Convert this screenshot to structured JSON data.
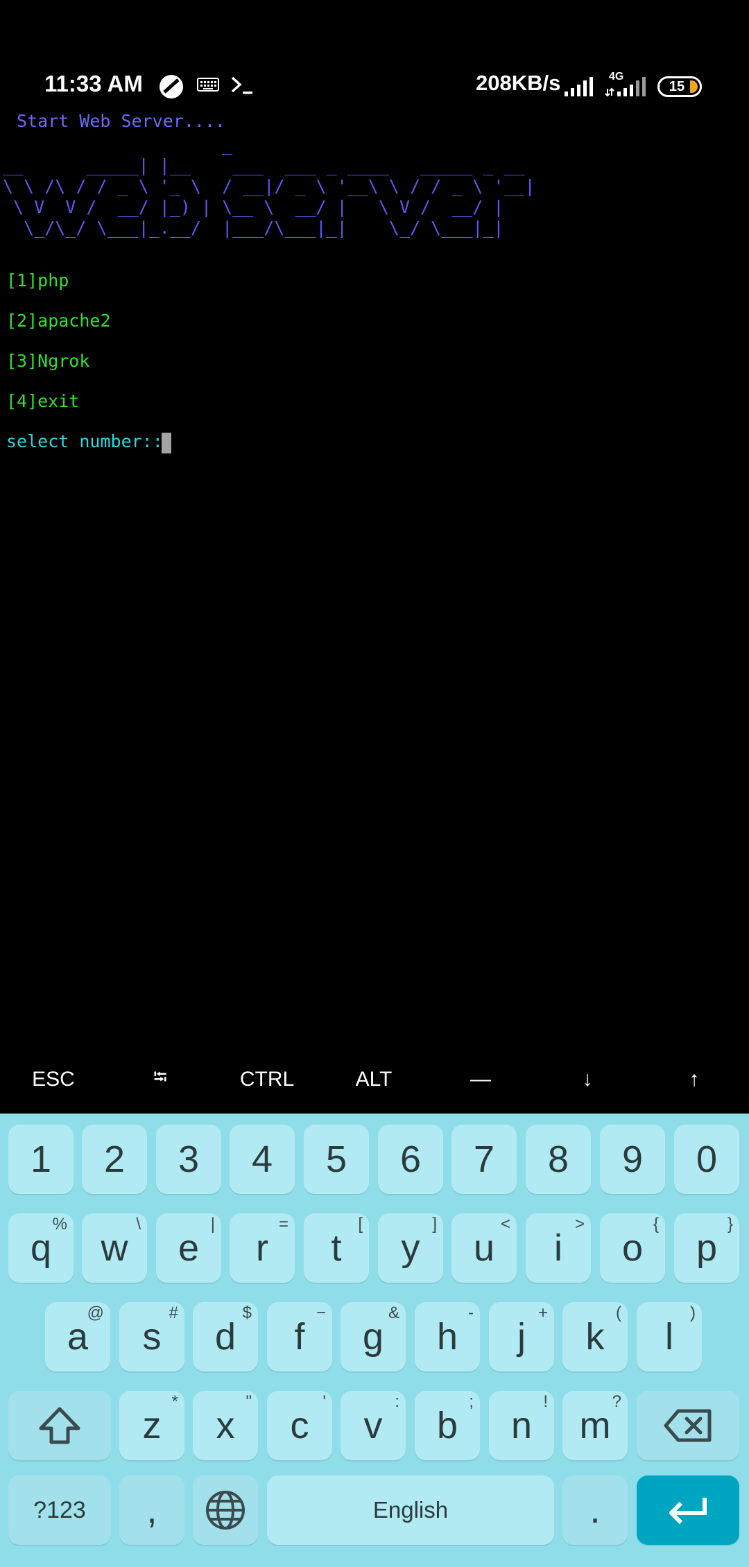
{
  "status_bar": {
    "time": "11:33 AM",
    "speed": "208KB/s",
    "network_type": "4G",
    "battery": "15"
  },
  "terminal": {
    "title": "Start Web Server....",
    "ascii_art": "                     _\n__      _____| |__    ___  ___ _ ____   _____ _ __\n\\ \\ /\\ / / _ \\ '_ \\  / __|/ _ \\ '__\\ \\ / / _ \\ '__|\n \\ V  V /  __/ |_) | \\__ \\  __/ |   \\ V /  __/ |\n  \\_/\\_/ \\___|_.__/  |___/\\___|_|    \\_/ \\___|_|",
    "menu": [
      "[1]php",
      "[2]apache2",
      "[3]Ngrok",
      "[4]exit"
    ],
    "prompt": "select number::"
  },
  "extra_keys": [
    "ESC",
    "⭾",
    "CTRL",
    "ALT",
    "—",
    "↓",
    "↑"
  ],
  "keyboard": {
    "number_row": [
      "1",
      "2",
      "3",
      "4",
      "5",
      "6",
      "7",
      "8",
      "9",
      "0"
    ],
    "row1": [
      {
        "key": "q",
        "alt": "%"
      },
      {
        "key": "w",
        "alt": "\\"
      },
      {
        "key": "e",
        "alt": "|"
      },
      {
        "key": "r",
        "alt": "="
      },
      {
        "key": "t",
        "alt": "["
      },
      {
        "key": "y",
        "alt": "]"
      },
      {
        "key": "u",
        "alt": "<"
      },
      {
        "key": "i",
        "alt": ">"
      },
      {
        "key": "o",
        "alt": "{"
      },
      {
        "key": "p",
        "alt": "}"
      }
    ],
    "row2": [
      {
        "key": "a",
        "alt": "@"
      },
      {
        "key": "s",
        "alt": "#"
      },
      {
        "key": "d",
        "alt": "$"
      },
      {
        "key": "f",
        "alt": "−"
      },
      {
        "key": "g",
        "alt": "&"
      },
      {
        "key": "h",
        "alt": "-"
      },
      {
        "key": "j",
        "alt": "+"
      },
      {
        "key": "k",
        "alt": "("
      },
      {
        "key": "l",
        "alt": ")"
      }
    ],
    "row3": [
      {
        "key": "z",
        "alt": "*"
      },
      {
        "key": "x",
        "alt": "\""
      },
      {
        "key": "c",
        "alt": "'"
      },
      {
        "key": "v",
        "alt": ":"
      },
      {
        "key": "b",
        "alt": ";"
      },
      {
        "key": "n",
        "alt": "!"
      },
      {
        "key": "m",
        "alt": "?"
      }
    ],
    "symbols_label": "?123",
    "comma": ",",
    "space_label": "English",
    "period": "."
  },
  "colors": {
    "title": "#6a6af7",
    "ascii": "#5a5af0",
    "menu": "#2fe02f",
    "prompt": "#2fd3e6",
    "keyboard_bg": "#8fdde9",
    "key_bg": "#b1eaf3",
    "enter_key": "#00a5c2"
  }
}
